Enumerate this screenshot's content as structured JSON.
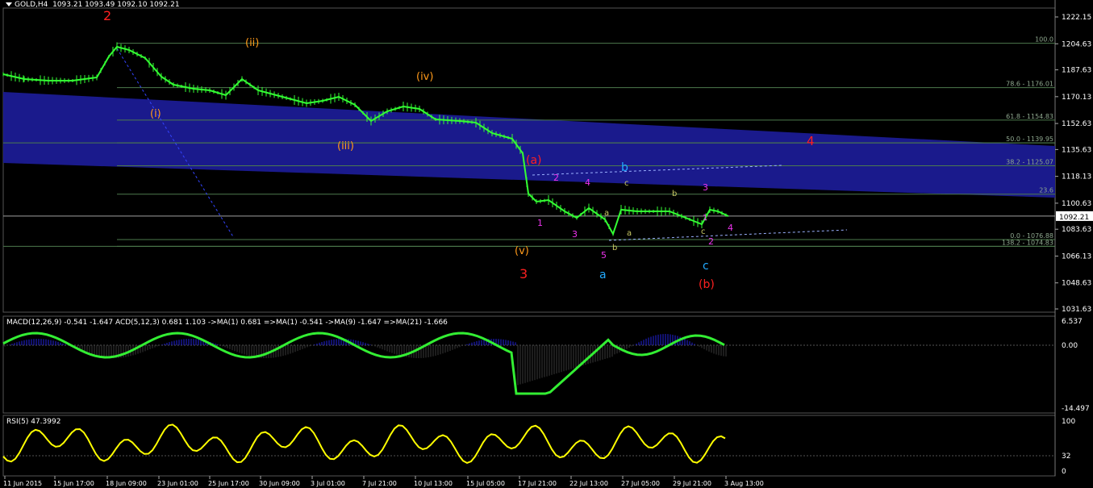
{
  "colors": {
    "background": "#000000",
    "candle": "#33ff33",
    "channel": "#1a1a8c",
    "fib_line": "#4d7a4d",
    "fib_text": "#8fa88f",
    "macd_hist_pos": "#2222dd",
    "macd_hist_neg": "#3a3a3a",
    "macd_line": "#33ee33",
    "rsi_line": "#ffff00",
    "wave_red": "#ff2020",
    "wave_orange": "#ff9a1a",
    "wave_magenta": "#ee33ee",
    "wave_cyan": "#22aaff",
    "wave_olive": "#c8c864"
  },
  "header": {
    "symbol": "GOLD,H4",
    "ohlc": "1093.21 1093.49 1092.10 1092.21"
  },
  "price_axis": {
    "ticks": [
      "1222.15",
      "1204.63",
      "1187.63",
      "1170.13",
      "1152.63",
      "1135.63",
      "1118.13",
      "1100.63",
      "1083.63",
      "1066.13",
      "1048.63",
      "1031.63"
    ],
    "current_price": "1092.21"
  },
  "fibonacci": [
    {
      "label": "100.0",
      "price": 1205.0
    },
    {
      "label": "78.6 - 1176.01",
      "price": 1176.01
    },
    {
      "label": "61.8 - 1154.83",
      "price": 1154.83
    },
    {
      "label": "50.0 - 1139.95",
      "price": 1139.95
    },
    {
      "label": "38.2 - 1125.07",
      "price": 1125.07
    },
    {
      "label": "23.6",
      "price": 1106.5
    },
    {
      "label": "0.0 - 1076.88",
      "price": 1076.88
    },
    {
      "label": "138.2 - 1074.83",
      "price": 1072.5
    }
  ],
  "macd": {
    "header": "MACD(12,26,9) -0.541 -1.647    ACD(5,12,3) 0.681 1.103  ->MA(1) 0.681  =>MA(1) -0.541  ->MA(9) -1.647  =>MA(21) -1.666",
    "ticks": [
      "6.537",
      "0.00",
      "-14.497"
    ]
  },
  "rsi": {
    "header": "RSI(5) 47.3992",
    "ticks": [
      "100",
      "32",
      "0"
    ]
  },
  "time_axis": [
    "11 Jun 2015",
    "15 Jun 17:00",
    "18 Jun 09:00",
    "23 Jun 01:00",
    "25 Jun 17:00",
    "30 Jun 09:00",
    "3 Jul 01:00",
    "7 Jul 21:00",
    "10 Jul 13:00",
    "15 Jul 05:00",
    "17 Jul 21:00",
    "22 Jul 13:00",
    "27 Jul 05:00",
    "29 Jul 21:00",
    "3 Aug 13:00"
  ],
  "waves": [
    {
      "text": "2",
      "color": "red"
    },
    {
      "text": "3",
      "color": "red"
    },
    {
      "text": "4",
      "color": "red"
    },
    {
      "text": "(a)",
      "color": "red"
    },
    {
      "text": "(b)",
      "color": "red"
    },
    {
      "text": "(ii)",
      "color": "orange"
    },
    {
      "text": "(iv)",
      "color": "orange"
    },
    {
      "text": "(i)",
      "color": "orange"
    },
    {
      "text": "(iii)",
      "color": "orange"
    },
    {
      "text": "(v)",
      "color": "orange"
    },
    {
      "text": "b",
      "color": "cyan"
    },
    {
      "text": "a",
      "color": "cyan"
    },
    {
      "text": "c",
      "color": "cyan"
    },
    {
      "text": "1",
      "color": "magenta"
    },
    {
      "text": "2",
      "color": "magenta"
    },
    {
      "text": "3",
      "color": "magenta"
    },
    {
      "text": "4",
      "color": "magenta"
    },
    {
      "text": "5",
      "color": "magenta"
    },
    {
      "text": "3",
      "color": "magenta"
    },
    {
      "text": "4",
      "color": "magenta"
    },
    {
      "text": "2",
      "color": "magenta"
    },
    {
      "text": "c",
      "color": "olive"
    },
    {
      "text": "a",
      "color": "olive"
    },
    {
      "text": "b",
      "color": "olive"
    },
    {
      "text": "a",
      "color": "olive"
    },
    {
      "text": "b",
      "color": "olive"
    },
    {
      "text": "c",
      "color": "olive"
    },
    {
      "text": "1",
      "color": "magenta"
    }
  ]
}
